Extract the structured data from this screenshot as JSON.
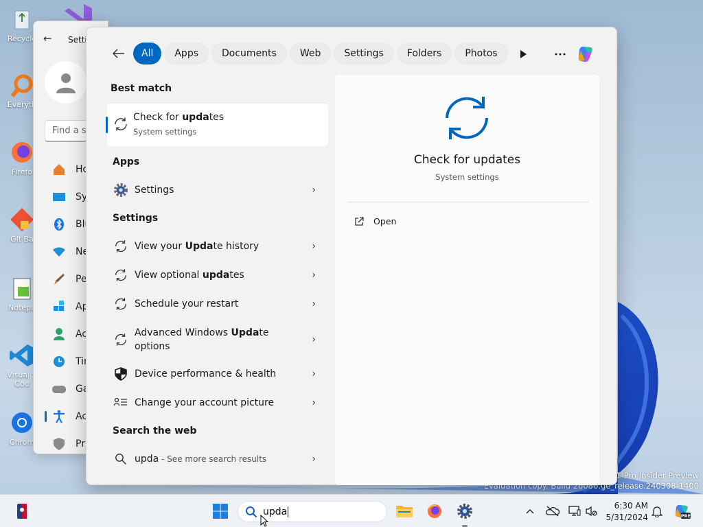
{
  "desktop": {
    "icons": [
      {
        "label": "Recycle",
        "icon": "recycle-bin-icon"
      },
      {
        "label": "Everyth",
        "icon": "everything-icon"
      },
      {
        "label": "Firefo",
        "icon": "firefox-icon"
      },
      {
        "label": "Git Ba",
        "icon": "git-bash-icon"
      },
      {
        "label": "Notepa",
        "icon": "notepad-plus-icon"
      },
      {
        "label": "Visual S",
        "label2": "Cod",
        "icon": "vscode-icon"
      },
      {
        "label": "Chrom",
        "icon": "chrome-icon"
      }
    ],
    "watermark_line1": "11 Pro Insider Preview",
    "watermark_line2": "Evaluation copy. Build 26080.ge_release.240308-1400"
  },
  "settings_window": {
    "title": "Setti",
    "find_placeholder": "Find a se",
    "nav": [
      {
        "label": "Ho",
        "icon": "home-icon"
      },
      {
        "label": "Sys",
        "icon": "system-icon"
      },
      {
        "label": "Blu",
        "icon": "bluetooth-icon"
      },
      {
        "label": "Ne",
        "icon": "network-icon"
      },
      {
        "label": "Per",
        "icon": "personalization-icon"
      },
      {
        "label": "Ap",
        "icon": "apps-icon"
      },
      {
        "label": "Acc",
        "icon": "accounts-icon"
      },
      {
        "label": "Tin",
        "icon": "time-icon"
      },
      {
        "label": "Ga",
        "icon": "gaming-icon"
      },
      {
        "label": "Acc",
        "icon": "accessibility-icon",
        "active": true
      },
      {
        "label": "Pri",
        "icon": "privacy-icon"
      }
    ]
  },
  "search": {
    "filters": [
      "All",
      "Apps",
      "Documents",
      "Web",
      "Settings",
      "Folders",
      "Photos"
    ],
    "active_filter": "All",
    "sections": {
      "best_match": "Best match",
      "apps": "Apps",
      "settings": "Settings",
      "web": "Search the web"
    },
    "best_match": {
      "title_pre": "Check for ",
      "title_bold": "upda",
      "title_post": "tes",
      "subtitle": "System settings"
    },
    "apps": [
      {
        "label": "Settings",
        "icon": "gear-icon"
      }
    ],
    "settings_results": [
      {
        "pre": "View your ",
        "bold": "Upda",
        "post": "te history",
        "icon": "sync-icon"
      },
      {
        "pre": "View optional ",
        "bold": "upda",
        "post": "tes",
        "icon": "sync-icon"
      },
      {
        "pre": "Schedule your restart",
        "bold": "",
        "post": "",
        "icon": "sync-icon"
      },
      {
        "pre": "Advanced Windows ",
        "bold": "Upda",
        "post": "te",
        "line2": "options",
        "icon": "sync-icon"
      },
      {
        "pre": "Device performance & health",
        "bold": "",
        "post": "",
        "icon": "shield-icon"
      },
      {
        "pre": "Change your account picture",
        "bold": "",
        "post": "",
        "icon": "account-list-icon"
      }
    ],
    "web_result": {
      "query": "upda",
      "suffix": " - See more search results"
    },
    "preview": {
      "title": "Check for updates",
      "subtitle": "System settings",
      "open_label": "Open"
    }
  },
  "taskbar": {
    "search_text": "upda",
    "time": "6:30 AM",
    "date": "5/31/2024"
  },
  "colors": {
    "accent": "#0067c0"
  }
}
